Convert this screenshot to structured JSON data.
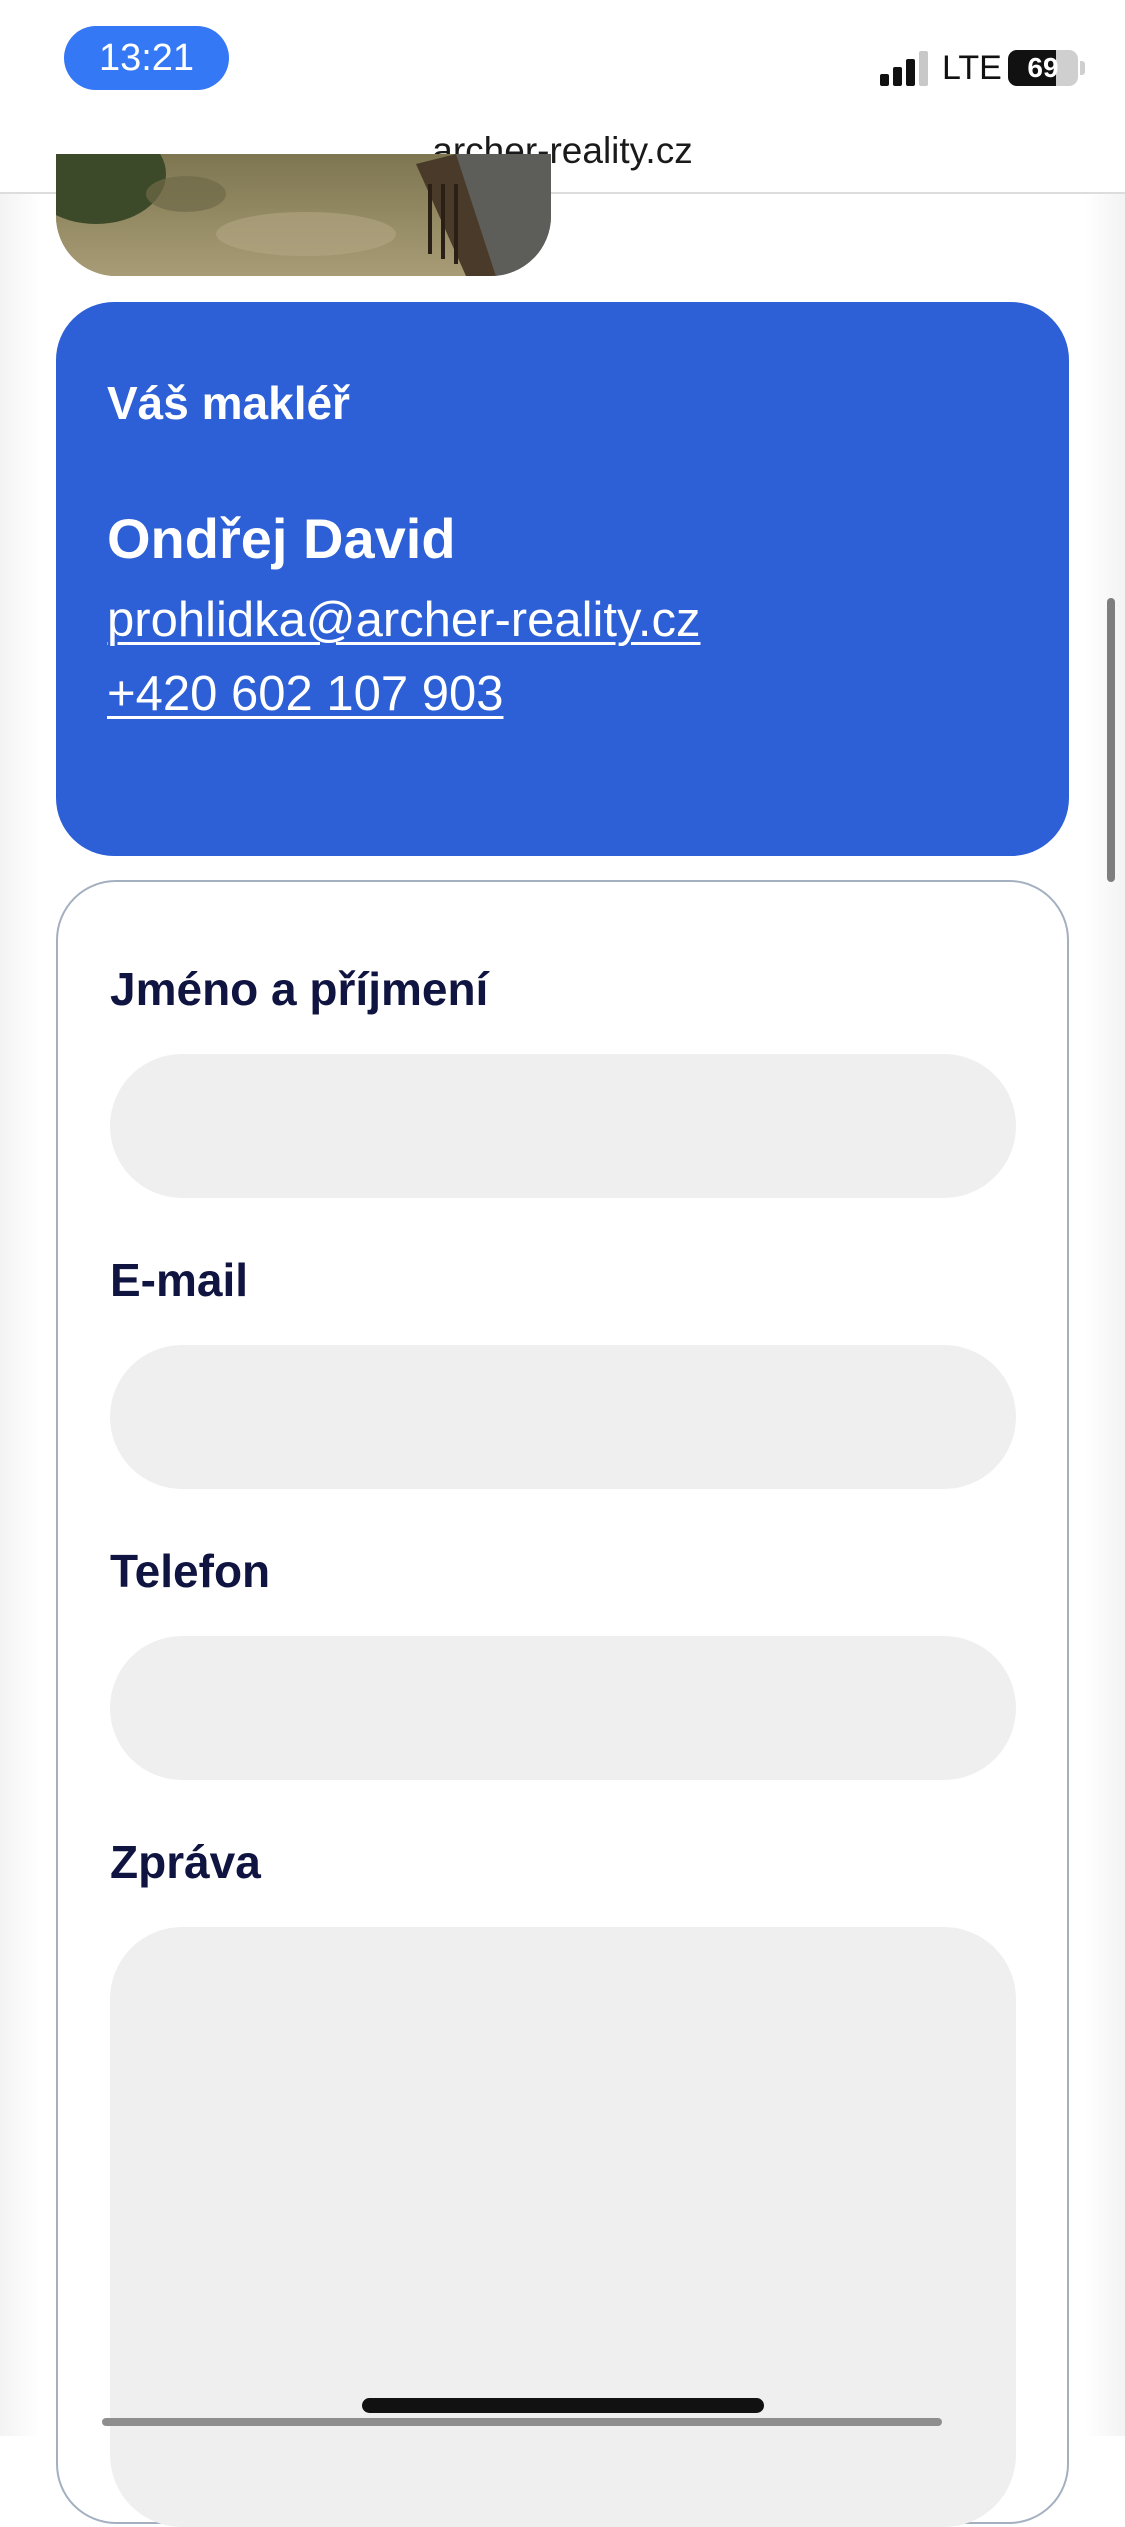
{
  "status_bar": {
    "time": "13:21",
    "network": "LTE",
    "battery_level": "69",
    "battery_fraction": 0.69,
    "signal_bars": 3,
    "signal_bars_total": 4,
    "time_pill_color": "#3478f6"
  },
  "browser": {
    "url": "archer-reality.cz"
  },
  "agent_card": {
    "heading": "Váš makléř",
    "name": "Ondřej David",
    "email": "prohlidka@archer-reality.cz",
    "phone": "+420 602 107 903",
    "background_color": "#2d60d6"
  },
  "contact_form": {
    "fields": [
      {
        "label": "Jméno a příjmení",
        "value": "",
        "type": "text"
      },
      {
        "label": "E-mail",
        "value": "",
        "type": "email"
      },
      {
        "label": "Telefon",
        "value": "",
        "type": "tel"
      },
      {
        "label": "Zpráva",
        "value": "",
        "type": "textarea"
      }
    ]
  }
}
